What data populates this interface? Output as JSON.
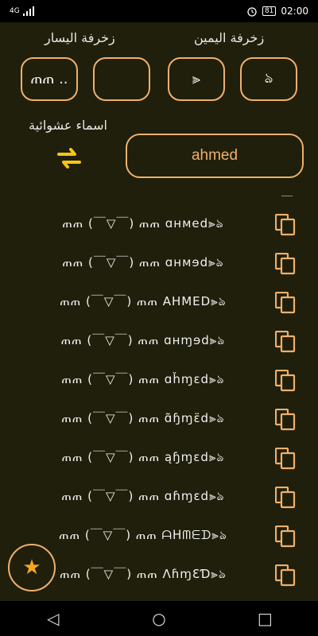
{
  "status": {
    "signal": "4G",
    "battery": "81",
    "time": "02:00"
  },
  "header": {
    "right_deco_label": "زخرفة اليمين",
    "left_deco_label": "زخرفة اليسار"
  },
  "deco_buttons": {
    "left_1": "ጠጠ ..",
    "left_2": "",
    "right_1": "⫸",
    "right_2": "ঌ"
  },
  "random_names_label": "اسماء عشوائية",
  "name_input": {
    "value": "ahmed"
  },
  "results": [
    "ጠጠ (￣▽￣) ጠጠ  ɑʜмеd⫸ঌ",
    "ጠጠ (￣▽￣) ጠጠ  ɑʜмɘd⫸ঌ",
    "ጠጠ (￣▽￣) ጠጠ  ΑΗΜΕD⫸ঌ",
    "ጠጠ (￣▽￣) ጠጠ  ɑʜɱɘd⫸ঌ",
    "ጠጠ (￣▽￣) ጠጠ  ɑȟɱɛd⫸ঌ",
    "ጠጠ (￣▽￣) ጠጠ  ɑ̃ɧɱɛ̈d⫸ঌ",
    "ጠጠ (￣▽￣) ጠጠ  ąɧɱɛd⫸ঌ",
    "ጠጠ (￣▽￣) ጠጠ  ɑɦɱɛd⫸ঌ",
    "ጠጠ (￣▽￣) ጠጠ  ᗩᕼᗰᗴᗪ⫸ঌ",
    "ጠጠ (￣▽￣) ጠጠ  ΛɦɱƐƊ⫸ঌ"
  ],
  "fab_icon": "★",
  "nav": {
    "back": "◁",
    "home": "○",
    "recent": "□"
  }
}
